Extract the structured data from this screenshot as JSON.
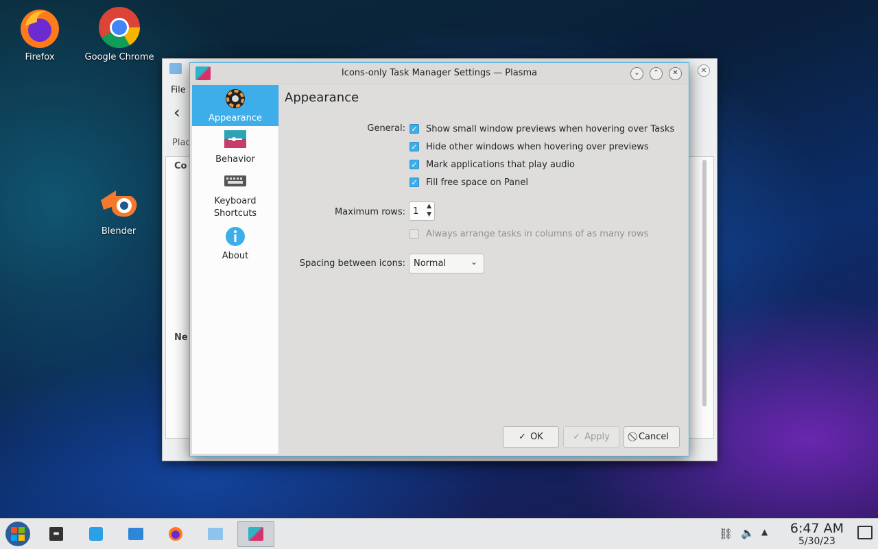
{
  "desktop": {
    "icons": [
      {
        "label": "Firefox",
        "icon": "firefox-icon"
      },
      {
        "label": "Google Chrome",
        "icon": "chrome-icon"
      },
      {
        "label": "Blender",
        "icon": "blender-icon"
      }
    ]
  },
  "background_window": {
    "menu_file": "File",
    "places_label": "Plac",
    "section1": "Co",
    "section2": "Ne"
  },
  "dialog": {
    "title": "Icons-only Task Manager Settings — Plasma",
    "sidebar": [
      {
        "label": "Appearance",
        "icon": "appearance-icon",
        "active": true
      },
      {
        "label": "Behavior",
        "icon": "behavior-icon",
        "active": false
      },
      {
        "label": "Keyboard\nShortcuts",
        "icon": "keyboard-icon",
        "active": false
      },
      {
        "label": "About",
        "icon": "info-icon",
        "active": false
      }
    ],
    "heading": "Appearance",
    "general_label": "General:",
    "checkboxes": [
      {
        "label": "Show small window previews when hovering over Tasks",
        "checked": true
      },
      {
        "label": "Hide other windows when hovering over previews",
        "checked": true
      },
      {
        "label": "Mark applications that play audio",
        "checked": true
      },
      {
        "label": "Fill free space on Panel",
        "checked": true
      }
    ],
    "max_rows_label": "Maximum rows:",
    "max_rows_value": "1",
    "always_arrange_label": "Always arrange tasks in columns of as many rows",
    "spacing_label": "Spacing between icons:",
    "spacing_value": "Normal",
    "buttons": {
      "ok": "OK",
      "apply": "Apply",
      "cancel": "Cancel"
    }
  },
  "taskbar": {
    "time": "6:47 AM",
    "date": "5/30/23"
  },
  "colors": {
    "accent": "#3daee9",
    "window_bg": "#dedddc",
    "taskbar_bg": "#e7e8ea"
  }
}
